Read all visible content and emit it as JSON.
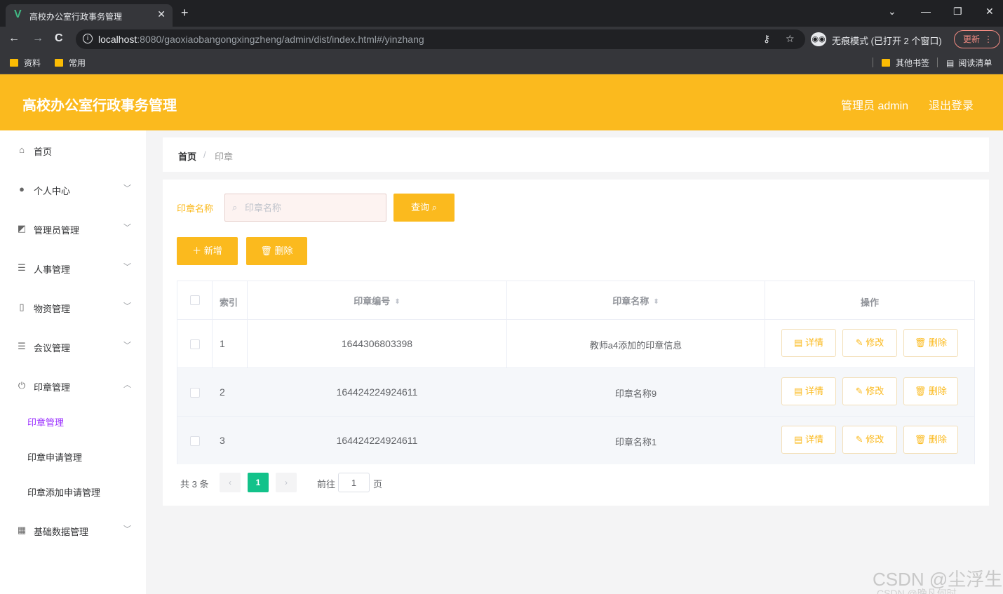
{
  "browser": {
    "tab_title": "高校办公室行政事务管理",
    "url_host": "localhost",
    "url_rest": ":8080/gaoxiaobangongxingzheng/admin/dist/index.html#/yinzhang",
    "incognito_label": "无痕模式 (已打开 2 个窗口)",
    "update_label": "更新",
    "bookmarks": [
      "资料",
      "常用"
    ],
    "bookmarks_right": [
      "其他书签",
      "阅读清单"
    ]
  },
  "header": {
    "title": "高校办公室行政事务管理",
    "user": "管理员 admin",
    "logout": "退出登录"
  },
  "sidebar": {
    "items": [
      {
        "label": "首页",
        "icon": "home-icon"
      },
      {
        "label": "个人中心",
        "icon": "user-icon"
      },
      {
        "label": "管理员管理",
        "icon": "chart-icon"
      },
      {
        "label": "人事管理",
        "icon": "list-icon"
      },
      {
        "label": "物资管理",
        "icon": "mic-icon"
      },
      {
        "label": "会议管理",
        "icon": "list-icon"
      },
      {
        "label": "印章管理",
        "icon": "power-icon"
      },
      {
        "label": "基础数据管理",
        "icon": "grid-icon"
      }
    ],
    "subitems": [
      "印章管理",
      "印章申请管理",
      "印章添加申请管理"
    ]
  },
  "breadcrumb": {
    "home": "首页",
    "sep": "/",
    "current": "印章"
  },
  "search": {
    "label": "印章名称",
    "placeholder": "印章名称",
    "query_button": "查询",
    "add_button": "新增",
    "delete_button": "删除"
  },
  "table": {
    "headers": {
      "index": "索引",
      "code": "印章编号",
      "name": "印章名称",
      "ops": "操作"
    },
    "rows": [
      {
        "index": "1",
        "code": "1644306803398",
        "name": "教师a4添加的印章信息"
      },
      {
        "index": "2",
        "code": "164424224924611",
        "name": "印章名称9"
      },
      {
        "index": "3",
        "code": "164424224924611",
        "name": "印章名称1"
      }
    ],
    "op_labels": {
      "detail": "详情",
      "edit": "修改",
      "delete": "删除"
    }
  },
  "pagination": {
    "total": "共 3 条",
    "current_page": "1",
    "goto_label": "前往",
    "goto_value": "1",
    "page_suffix": "页"
  },
  "watermark": "CSDN @尘浮生",
  "watermark2": "CSDN @晚凡何时",
  "colors": {
    "accent": "#fbba1e",
    "active_page": "#13c28a",
    "active_submenu": "#9b30ff"
  }
}
